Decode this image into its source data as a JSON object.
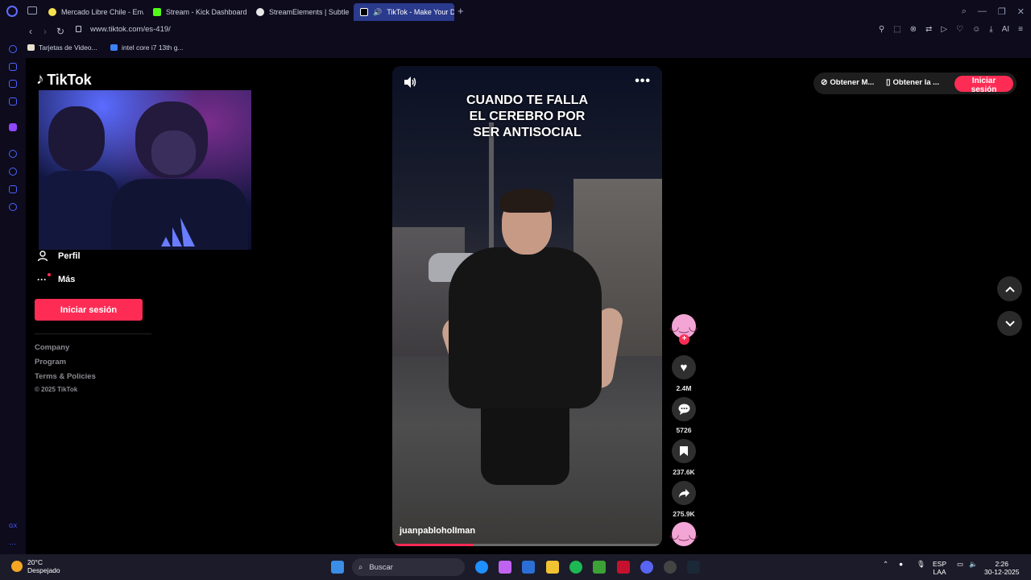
{
  "browser": {
    "tabs": [
      {
        "label": "Mercado Libre Chile - Env",
        "color": "#f5e050"
      },
      {
        "label": "Stream - Kick Dashboard",
        "color": "#53fc18"
      },
      {
        "label": "StreamElements | Subtle S",
        "color": "#e8e8e8"
      },
      {
        "label": "TikTok - Make Your Da",
        "color": "#000000"
      }
    ],
    "url": "www.tiktok.com/es-419/",
    "bookmarks": [
      {
        "label": "Tarjetas de Video...",
        "color": "#e9e0d0"
      },
      {
        "label": "intel core i7 13th g...",
        "color": "#3b82f6"
      }
    ],
    "ai_label": "AI"
  },
  "tiktok": {
    "logo": "TikTok",
    "sidebar": {
      "profile": "Perfil",
      "more": "Más",
      "login": "Iniciar sesión",
      "footer": [
        "Company",
        "Program",
        "Terms & Policies"
      ],
      "copyright": "© 2025 TikTok"
    },
    "video": {
      "caption": "CUANDO TE FALLA\nEL CEREBRO POR\nSER ANTISOCIAL",
      "author": "juanpabloholIman",
      "progress": 0.3
    },
    "actions": {
      "likes": "2.4M",
      "comments": "5726",
      "saves": "237.6K",
      "shares": "275.9K"
    },
    "topbar": {
      "get_coins": "Obtener M...",
      "get_app": "Obtener la ...",
      "login": "Iniciar sesión"
    }
  },
  "taskbar": {
    "weather_temp": "20°C",
    "weather_desc": "Despejado",
    "search": "Buscar",
    "lang": "ESP",
    "lang2": "LAA",
    "time": "2:26",
    "date": "30-12-2025"
  }
}
